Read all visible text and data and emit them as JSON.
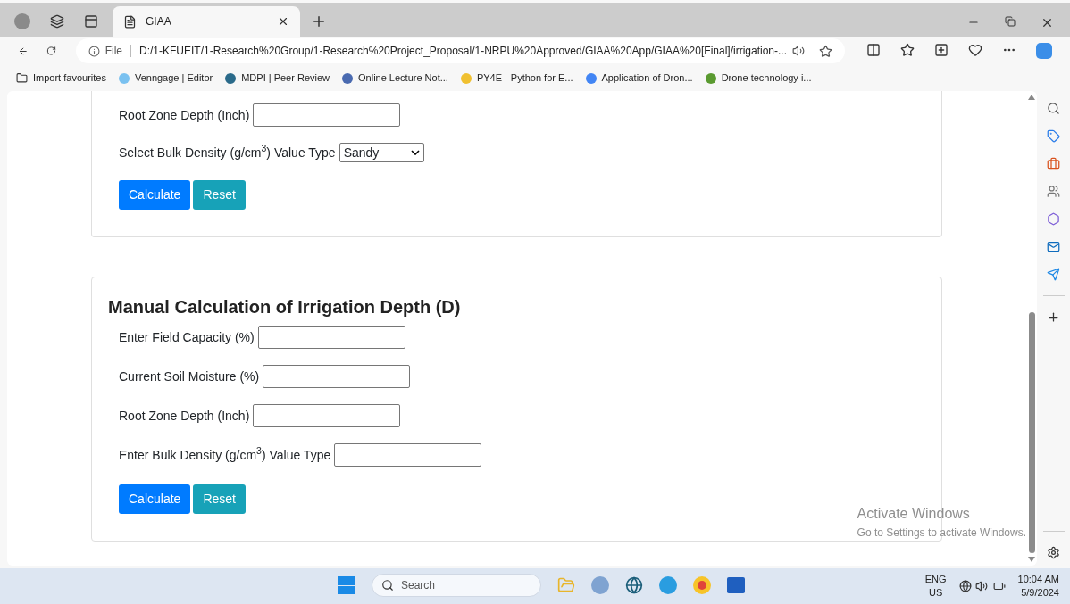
{
  "browser": {
    "tabs": [
      {
        "title": "GIAA",
        "selected": true
      }
    ],
    "address": {
      "scheme": "File",
      "url": "D:/1-KFUEIT/1-Research%20Group/1-Research%20Project_Proposal/1-NRPU%20Approved/GIAA%20App/GIAA%20[Final]/irrigation-..."
    },
    "bookmarks": [
      "Import favourites",
      "Venngage | Editor",
      "MDPI | Peer Review",
      "Online Lecture Not...",
      "PY4E - Python for E...",
      "Application of Dron...",
      "Drone technology i..."
    ]
  },
  "sections": [
    {
      "fields": [
        {
          "kind": "input",
          "label": "Root Zone Depth (Inch)"
        },
        {
          "kind": "select",
          "label": "Select Bulk Density (g/cm$^{3}$) Value Type",
          "value": "Sandy"
        }
      ],
      "buttons": [
        "Calculate",
        "Reset"
      ]
    },
    {
      "title": "Manual Calculation of Irrigation Depth (D)",
      "fields": [
        {
          "kind": "input",
          "label": "Enter Field Capacity (%)"
        },
        {
          "kind": "input",
          "label": "Current Soil Moisture (%)"
        },
        {
          "kind": "input",
          "label": "Root Zone Depth (Inch)"
        },
        {
          "kind": "input",
          "label": "Enter Bulk Density (g/cm$^{3}$) Value Type"
        }
      ],
      "buttons": [
        "Calculate",
        "Reset"
      ]
    }
  ],
  "activation_notice": {
    "title": "Activate Windows",
    "text": "Go to Settings to activate Windows."
  },
  "taskbar": {
    "search_placeholder": "Search",
    "language": "ENG",
    "region": "US",
    "time": "10:04 AM",
    "date": "5/9/2024"
  }
}
